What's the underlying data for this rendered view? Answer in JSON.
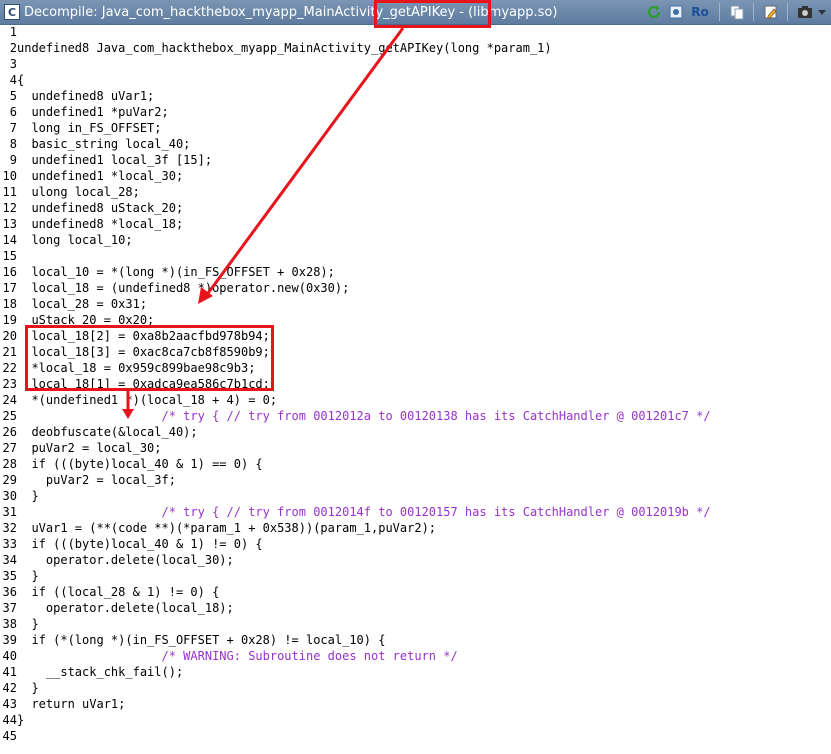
{
  "window": {
    "title": "Decompile: Java_com_hackthebox_myapp_MainActivity_getAPIKey -  (libmyapp.so)",
    "toolbar_ro_label": "Ro",
    "toolbar_icons": [
      "refresh-icon",
      "snapshot-icon",
      "read-only-icon",
      "copy-icon",
      "edit-icon",
      "camera-icon",
      "dropdown-icon"
    ]
  },
  "colors": {
    "highlight_box": "#e8141c",
    "titlebar": "#6a87a9"
  },
  "code": {
    "lines": [
      "",
      "undefined8 Java_com_hackthebox_myapp_MainActivity_getAPIKey(long *param_1)",
      "",
      "{",
      "  undefined8 uVar1;",
      "  undefined1 *puVar2;",
      "  long in_FS_OFFSET;",
      "  basic_string local_40;",
      "  undefined1 local_3f [15];",
      "  undefined1 *local_30;",
      "  ulong local_28;",
      "  undefined8 uStack_20;",
      "  undefined8 *local_18;",
      "  long local_10;",
      "",
      "  local_10 = *(long *)(in_FS_OFFSET + 0x28);",
      "  local_18 = (undefined8 *)operator.new(0x30);",
      "  local_28 = 0x31;",
      "  uStack_20 = 0x20;",
      "  local_18[2] = 0xa8b2aacfbd978b94;",
      "  local_18[3] = 0xac8ca7cb8f8590b9;",
      "  *local_18 = 0x959c899bae98c9b3;",
      "  local_18[1] = 0xadca9ea586c7b1cd;",
      "  *(undefined1 *)(local_18 + 4) = 0;",
      "                    /* try { // try from 0012012a to 00120138 has its CatchHandler @ 001201c7 */",
      "  deobfuscate(&local_40);",
      "  puVar2 = local_30;",
      "  if (((byte)local_40 & 1) == 0) {",
      "    puVar2 = local_3f;",
      "  }",
      "                    /* try { // try from 0012014f to 00120157 has its CatchHandler @ 0012019b */",
      "  uVar1 = (**(code **)(*param_1 + 0x538))(param_1,puVar2);",
      "  if (((byte)local_40 & 1) != 0) {",
      "    operator.delete(local_30);",
      "  }",
      "  if ((local_28 & 1) != 0) {",
      "    operator.delete(local_18);",
      "  }",
      "  if (*(long *)(in_FS_OFFSET + 0x28) != local_10) {",
      "                    /* WARNING: Subroutine does not return */",
      "    __stack_chk_fail();",
      "  }",
      "  return uVar1;",
      "}",
      ""
    ]
  }
}
